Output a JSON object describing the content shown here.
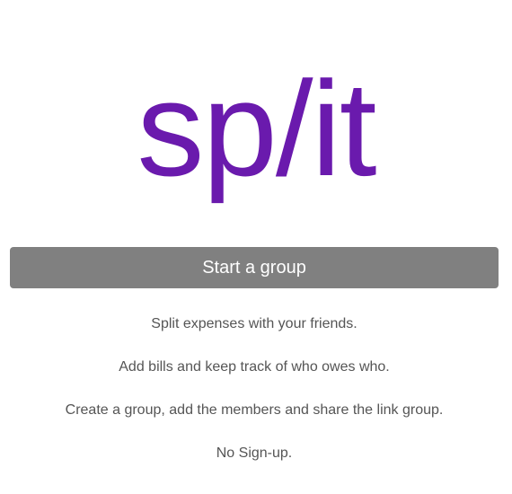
{
  "app": {
    "logo_text": "sp/it",
    "brand_color": "#6a1aad"
  },
  "actions": {
    "start_group_label": "Start a group",
    "button_color": "#808080"
  },
  "taglines": [
    "Split expenses with your friends.",
    "Add bills and keep track of who owes who.",
    "Create a group, add the members and share the link group.",
    "No Sign-up."
  ]
}
